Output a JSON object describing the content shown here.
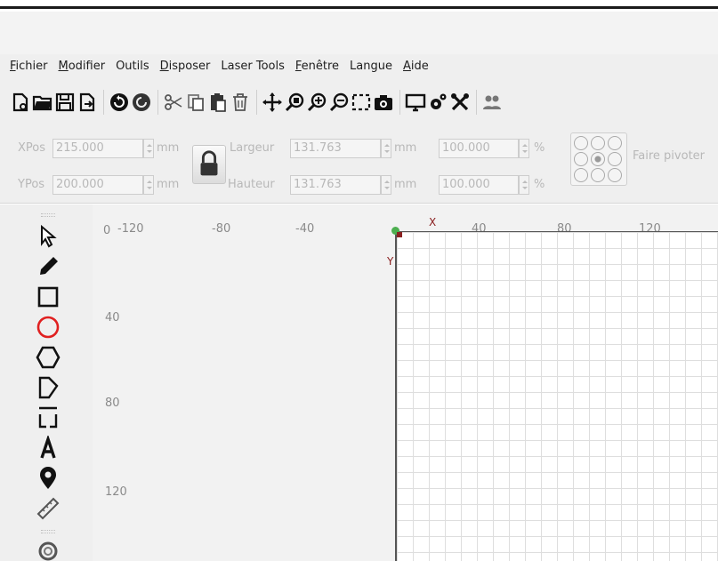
{
  "menu": [
    {
      "mnemonic": "F",
      "rest": "ichier"
    },
    {
      "mnemonic": "M",
      "rest": "odifier"
    },
    {
      "mnemonic": "",
      "rest": "Outils"
    },
    {
      "mnemonic": "D",
      "rest": "isposer"
    },
    {
      "mnemonic": "",
      "rest": "Laser Tools"
    },
    {
      "mnemonic": "F",
      "rest": "enêtre"
    },
    {
      "mnemonic": "",
      "rest": "Langue"
    },
    {
      "mnemonic": "A",
      "rest": "ide"
    }
  ],
  "toolbar_icons": [
    "new-file-icon",
    "open-folder-icon",
    "save-icon",
    "export-icon",
    "rotate-left-icon",
    "rotate-right-icon",
    "cut-icon",
    "copy-icon",
    "paste-icon",
    "delete-icon",
    "move-icon",
    "zoom-fit-icon",
    "zoom-in-icon",
    "zoom-out-icon",
    "select-area-icon",
    "camera-icon",
    "monitor-icon",
    "settings-icon",
    "tools-icon",
    "users-icon"
  ],
  "properties": {
    "xpos": {
      "label": "XPos",
      "value": "215.000",
      "unit": "mm"
    },
    "ypos": {
      "label": "YPos",
      "value": "200.000",
      "unit": "mm"
    },
    "width": {
      "label": "Largeur",
      "value": "131.763",
      "unit": "mm",
      "percent": "100.000",
      "percent_unit": "%"
    },
    "height": {
      "label": "Hauteur",
      "value": "131.763",
      "unit": "mm",
      "percent": "100.000",
      "percent_unit": "%"
    },
    "rotate_label": "Faire pivoter"
  },
  "left_tools": [
    "pointer-icon",
    "pencil-icon",
    "rectangle-icon",
    "ellipse-icon",
    "polygon-icon",
    "pentagon-icon",
    "frame-icon",
    "text-icon",
    "location-pin-icon",
    "ruler-icon",
    "spiral-icon"
  ],
  "ruler": {
    "origin": "0",
    "top_ticks": [
      "-120",
      "-80",
      "-40",
      "40",
      "80",
      "120"
    ],
    "left_ticks": [
      "40",
      "80",
      "120"
    ],
    "x_axis": "X",
    "y_axis": "Y"
  },
  "colors": {
    "accent_red": "#e02020",
    "axis_dark_red": "#8a2020",
    "origin_green": "#4caf50"
  }
}
